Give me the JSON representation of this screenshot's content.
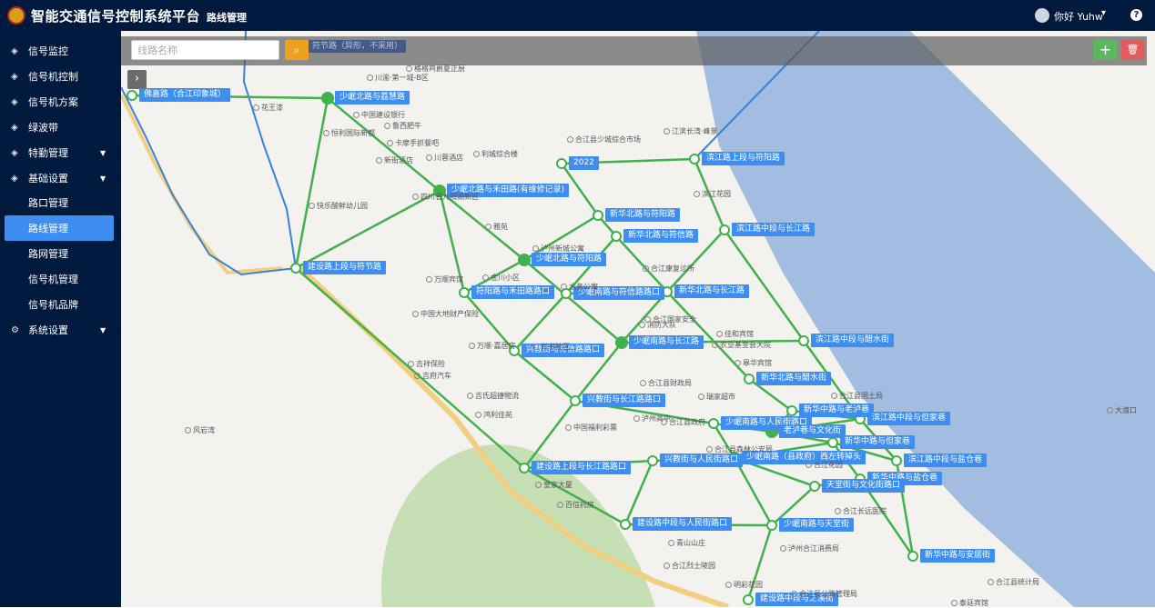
{
  "header": {
    "app_title": "智能交通信号控制系统平台",
    "page_name": "路线管理",
    "user_label": "你好 Yuhw",
    "help_icon": "question-icon"
  },
  "sidebar": {
    "items": [
      {
        "label": "信号监控",
        "icon": "layers-icon"
      },
      {
        "label": "信号机控制",
        "icon": "layers-icon"
      },
      {
        "label": "信号机方案",
        "icon": "layers-icon"
      },
      {
        "label": "绿波带",
        "icon": "layers-icon"
      },
      {
        "label": "特勤管理",
        "icon": "layers-icon",
        "expandable": true
      },
      {
        "label": "基础设置",
        "icon": "layers-icon",
        "expandable": true
      },
      {
        "label": "路口管理",
        "sub": true
      },
      {
        "label": "路线管理",
        "sub": true,
        "active": true
      },
      {
        "label": "路网管理",
        "sub": true
      },
      {
        "label": "信号机管理",
        "sub": true
      },
      {
        "label": "信号机品牌",
        "sub": true
      },
      {
        "label": "系统设置",
        "icon": "gear-icon",
        "expandable": true
      }
    ]
  },
  "toolbar": {
    "search_placeholder": "线路名称",
    "search_value": "",
    "hint_text": "符节路（异形，不采用）",
    "add_icon": "plus-icon",
    "delete_icon": "trash-icon",
    "collapse_icon": "chevron-right-icon"
  },
  "map": {
    "colors": {
      "route": "#41b14c",
      "label_bg": "#3d8ef0",
      "river": "#a3bde0",
      "park": "#c7dfb5"
    },
    "intersections": [
      {
        "label": "佛嘉路（合江印象城）"
      },
      {
        "label": "少岷北路与荔慧路"
      },
      {
        "label": "2022"
      },
      {
        "label": "滨江路上段与符阳路"
      },
      {
        "label": "少岷北路与禾田路(有维修记录)"
      },
      {
        "label": "新华北路与符阳路"
      },
      {
        "label": "滨江路中段与长江路"
      },
      {
        "label": "新华北路与符信路"
      },
      {
        "label": "建设路上段与符节路"
      },
      {
        "label": "少岷北路与符阳路"
      },
      {
        "label": "符阳路与禾田路路口"
      },
      {
        "label": "少岷南路与符信路路口"
      },
      {
        "label": "新华北路与长江路"
      },
      {
        "label": "少岷南路与长江路"
      },
      {
        "label": "滨江路中段与醋水街"
      },
      {
        "label": "兴教街与符信路路口"
      },
      {
        "label": "新华北路与醋水街"
      },
      {
        "label": "兴教街与长江路路口"
      },
      {
        "label": "新华中路与老泸巷"
      },
      {
        "label": "滨江路中段与但家巷"
      },
      {
        "label": "少岷南路与人民街路口"
      },
      {
        "label": "老泸巷与文化街"
      },
      {
        "label": "新华中路与但家巷"
      },
      {
        "label": "兴教街与人民街路口"
      },
      {
        "label": "少岷南路（县政府）西左转掉头"
      },
      {
        "label": "滨江路中段与盐仓巷"
      },
      {
        "label": "建设路上段与长江路路口"
      },
      {
        "label": "新华中路与盐仓巷"
      },
      {
        "label": "天堂街与文化街路口"
      },
      {
        "label": "建设路中段与人民街路口"
      },
      {
        "label": "少岷南路与天堂街"
      },
      {
        "label": "新华中路与安居街"
      },
      {
        "label": "建设路中段与之溪街"
      }
    ],
    "pois": [
      "川渝·第一城-B区",
      "格格鸡爵夏正厨",
      "花王漆",
      "中国建设银行",
      "鲁西肥牛",
      "恒利国际新都",
      "卡摩手抓餐吧",
      "新街酒店",
      "川蓉酒店",
      "利城综合楼",
      "四川省九阳湖新区",
      "快乐酸鲜幼儿园",
      "雅苑",
      "泸州新城公寓",
      "万顺宾馆",
      "金川小区",
      "水务公寓",
      "中国大地财产保险",
      "万顺·嘉居房",
      "尚书社区",
      "合江国家安全",
      "消防大队",
      "佳和宾馆",
      "农业基金会大院",
      "皋华宾馆",
      "合江县财政局",
      "瑞家超市",
      "泸州高中",
      "中国福利彩票",
      "吉祥保险",
      "吉府汽车",
      "吉氏超捷物流",
      "鸿利佳苑",
      "合江县政府",
      "合江县森林公安局",
      "皇家大厦",
      "百信药房",
      "合江长远医院",
      "泸州合江消费局",
      "青山山庄",
      "合江烈士陵园",
      "明彩花园",
      "合江县公路管理局",
      "泰廷宾馆",
      "合江县统计局",
      "合江花园",
      "大渡口",
      "风岩湾",
      "合江县国土局",
      "滨江花园",
      "合江康复诊所",
      "江滨长湾·峰景",
      "合江县少城综合市场"
    ]
  }
}
